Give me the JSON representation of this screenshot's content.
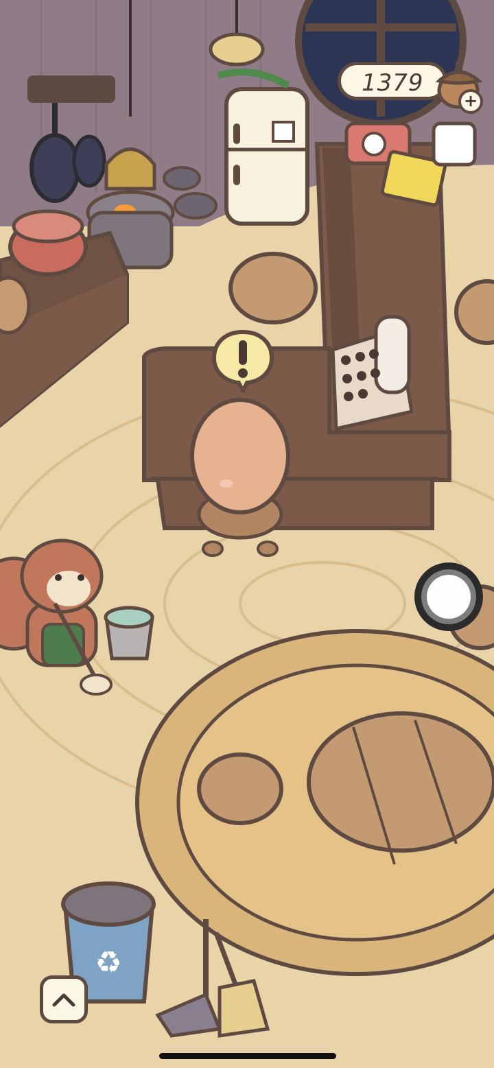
{
  "hud": {
    "coin_count": "1379",
    "currency_icon": "acorn-icon",
    "add_icon": "plus-icon"
  },
  "controls": {
    "joystick": "virtual-joystick",
    "expand_icon": "chevron-up-icon"
  },
  "characters": {
    "customer": "customer-egg-character",
    "staff": "squirrel-staff"
  },
  "notifications": {
    "alert_icon": "exclamation-bubble-icon"
  },
  "colors": {
    "floor": "#e9d3a8",
    "wall": "#8f7c86",
    "outline": "#5e4a40",
    "wood": "#8c6a55",
    "hud_bg": "#fbf6e6"
  }
}
